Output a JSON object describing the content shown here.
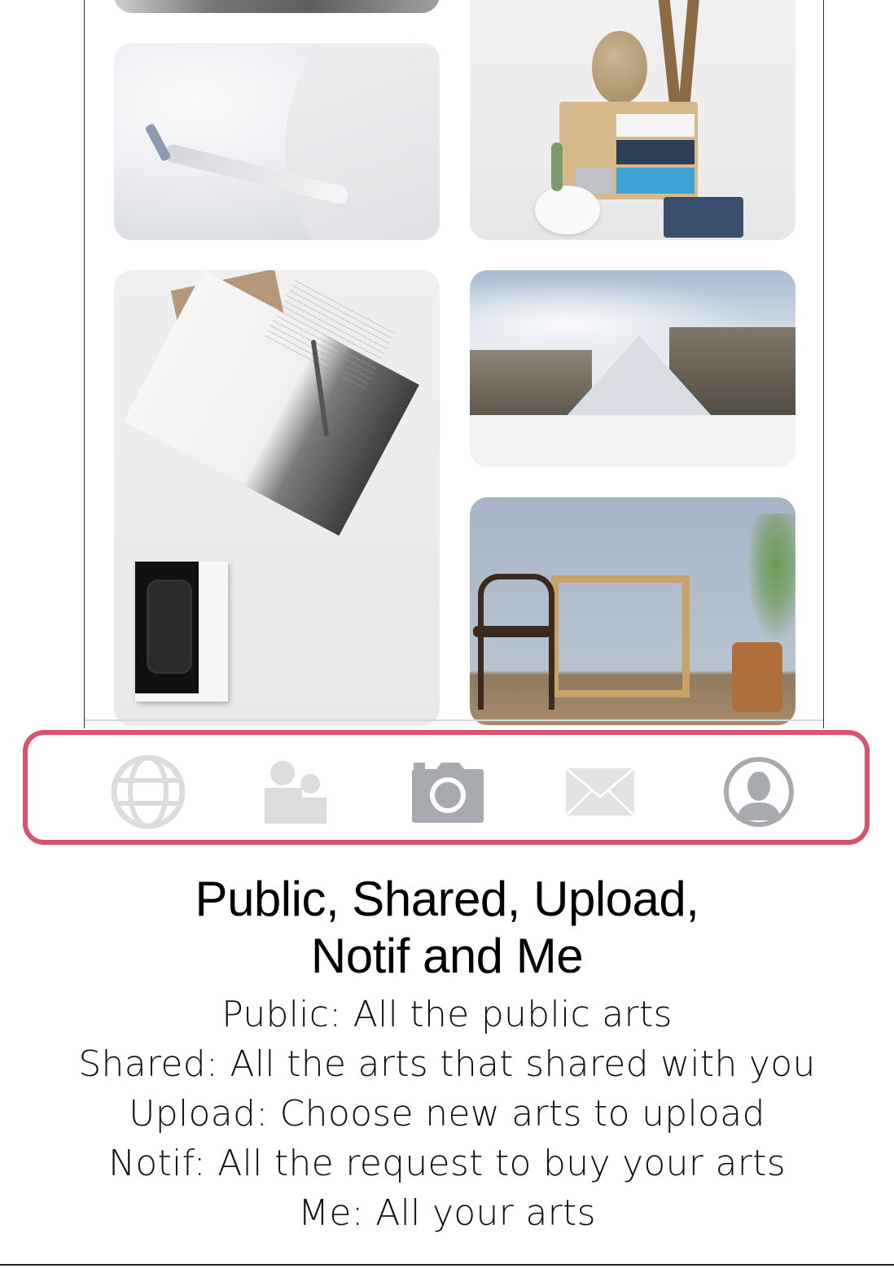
{
  "tab_bar": {
    "items": [
      {
        "id": "public",
        "icon": "globe-icon"
      },
      {
        "id": "shared",
        "icon": "people-icon"
      },
      {
        "id": "upload",
        "icon": "camera-icon"
      },
      {
        "id": "notif",
        "icon": "envelope-icon"
      },
      {
        "id": "me",
        "icon": "user-circle-icon"
      }
    ],
    "icon_color": "#a9acb0",
    "highlight_color": "#d9536e"
  },
  "caption": {
    "title_line1": "Public, Shared, Upload,",
    "title_line2": "Notif and Me",
    "lines": [
      "Public: All the public arts",
      "Shared: All the arts that shared with you",
      "Upload: Choose new arts to upload",
      "Notif: All the request to buy your arts",
      "Me: All your arts"
    ]
  }
}
